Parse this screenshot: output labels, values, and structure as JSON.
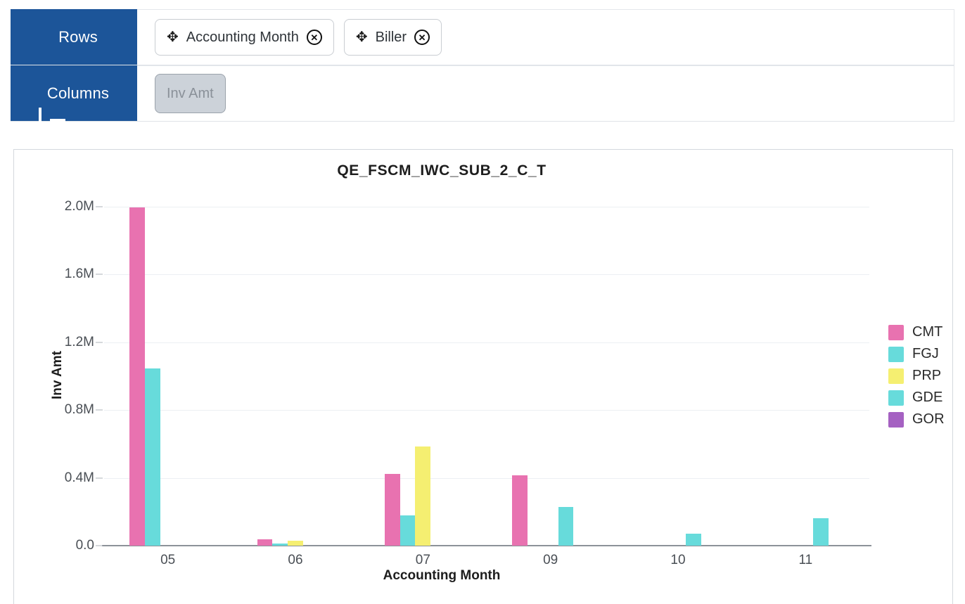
{
  "shelves": [
    {
      "id": "rows",
      "label": "Rows",
      "icon": "rows-icon",
      "fields": [
        {
          "label": "Accounting Month",
          "move_icon": "move-icon",
          "remove_icon": "remove-icon"
        },
        {
          "label": "Biller",
          "move_icon": "move-icon",
          "remove_icon": "remove-icon"
        }
      ]
    },
    {
      "id": "columns",
      "label": "Columns",
      "icon": "columns-icon",
      "measures": [
        {
          "label": "Inv Amt"
        }
      ]
    }
  ],
  "chart_data": {
    "type": "bar",
    "title": "QE_FSCM_IWC_SUB_2_C_T",
    "xlabel": "Accounting Month",
    "ylabel": "Inv Amt",
    "categories": [
      "05",
      "06",
      "07",
      "09",
      "10",
      "11"
    ],
    "ytick_labels": [
      "0.0",
      "0.4M",
      "0.8M",
      "1.2M",
      "1.6M",
      "2.0M"
    ],
    "ytick_values": [
      0,
      400000,
      800000,
      1200000,
      1600000,
      2000000
    ],
    "ylim": [
      0,
      2000000
    ],
    "grid": true,
    "legend_position": "right",
    "series": [
      {
        "name": "CMT",
        "color": "#E872B0",
        "values": [
          1995000,
          37000,
          422000,
          415000,
          0,
          0
        ]
      },
      {
        "name": "FGJ",
        "color": "#67DBDB",
        "values": [
          1045000,
          12000,
          179000,
          0,
          0,
          0
        ]
      },
      {
        "name": "PRP",
        "color": "#F5EF71",
        "values": [
          0,
          28000,
          587000,
          0,
          0,
          0
        ]
      },
      {
        "name": "GDE",
        "color": "#67DBDB",
        "values": [
          0,
          0,
          0,
          229000,
          70000,
          163000
        ]
      },
      {
        "name": "GOR",
        "color": "#A561C2",
        "values": [
          0,
          0,
          0,
          0,
          0,
          0
        ]
      }
    ]
  }
}
